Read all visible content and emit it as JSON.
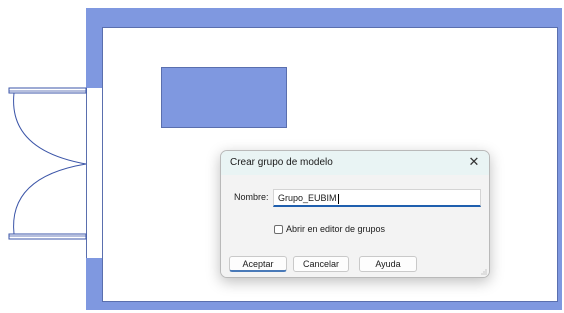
{
  "dialog": {
    "title": "Crear grupo de modelo",
    "close_glyph": "✕",
    "name_label": "Nombre:",
    "name_value": "Grupo_EUBIM",
    "checkbox_label": "Abrir en editor de grupos",
    "checkbox_checked": false,
    "buttons": {
      "accept": "Aceptar",
      "cancel": "Cancelar",
      "help": "Ayuda"
    }
  },
  "colors": {
    "wall_fill": "#7f98e0",
    "door_lines": "#3b55a8",
    "dialog_title_bg": "#e9f4f4",
    "input_focus_underline": "#1f5fae"
  },
  "icons": {
    "close": "close-icon",
    "resize": "resize-grip-icon"
  }
}
